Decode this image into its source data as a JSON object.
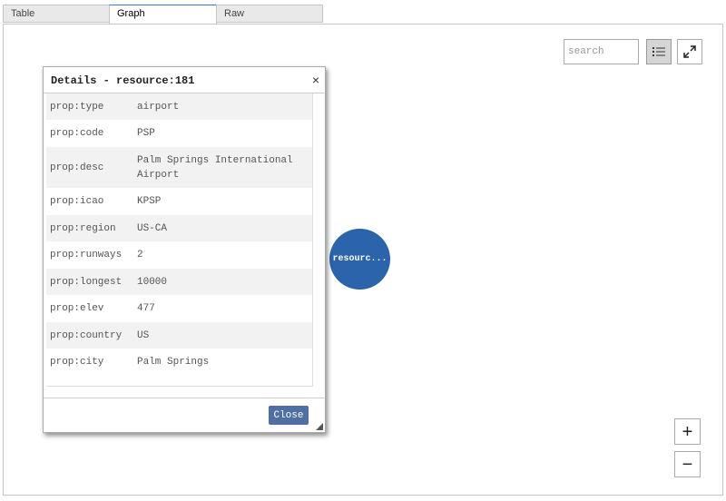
{
  "tabs": [
    {
      "label": "Table"
    },
    {
      "label": "Graph"
    },
    {
      "label": "Raw"
    }
  ],
  "toolbar": {
    "search_placeholder": "search",
    "list_icon": "list-icon",
    "expand_icon": "expand-icon"
  },
  "zoom": {
    "plus": "+",
    "minus": "−"
  },
  "node": {
    "label": "resourc..."
  },
  "dialog": {
    "title": "Details - resource:181",
    "close_x": "×",
    "close_label": "Close",
    "properties": [
      {
        "key": "prop:type",
        "value": "airport"
      },
      {
        "key": "prop:code",
        "value": "PSP"
      },
      {
        "key": "prop:desc",
        "value": "Palm Springs International Airport"
      },
      {
        "key": "prop:icao",
        "value": "KPSP"
      },
      {
        "key": "prop:region",
        "value": "US-CA"
      },
      {
        "key": "prop:runways",
        "value": "2"
      },
      {
        "key": "prop:longest",
        "value": "10000"
      },
      {
        "key": "prop:elev",
        "value": "477"
      },
      {
        "key": "prop:country",
        "value": "US"
      },
      {
        "key": "prop:city",
        "value": "Palm Springs"
      }
    ]
  },
  "colors": {
    "node": "#2b64aa",
    "close_button": "#4f6ea1",
    "active_tab_border": "#3d7bd1"
  }
}
